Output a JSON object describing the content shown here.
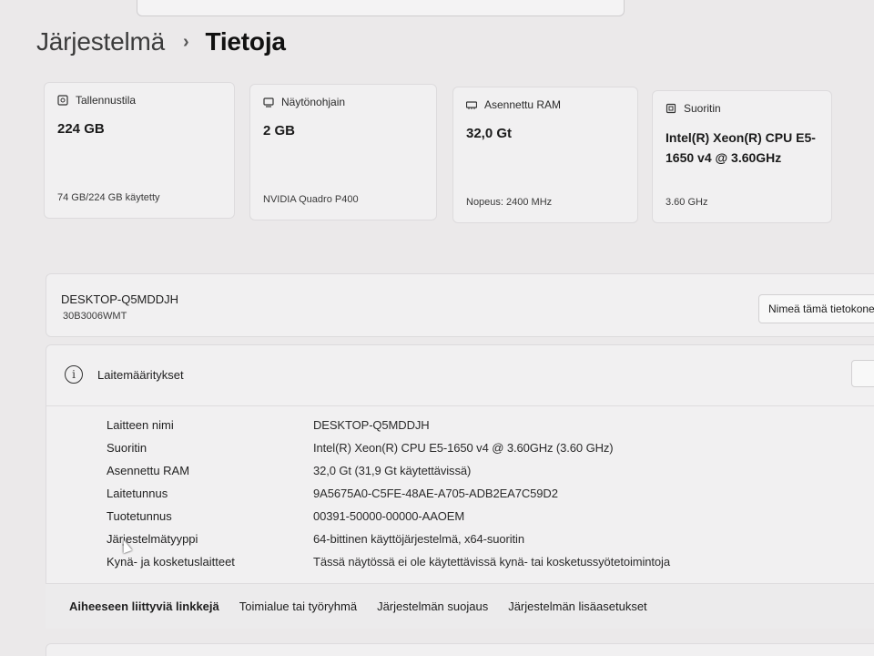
{
  "breadcrumb": {
    "parent": "Järjestelmä",
    "separator": "›",
    "current": "Tietoja"
  },
  "cards": [
    {
      "icon": "storage-icon",
      "label": "Tallennustila",
      "value": "224 GB",
      "sub": "74 GB/224 GB käytetty"
    },
    {
      "icon": "gpu-icon",
      "label": "Näytönohjain",
      "value": "2 GB",
      "sub": "NVIDIA Quadro P400"
    },
    {
      "icon": "ram-icon",
      "label": "Asennettu RAM",
      "value": "32,0 Gt",
      "sub": "Nopeus: 2400 MHz"
    },
    {
      "icon": "cpu-icon",
      "label": "Suoritin",
      "value": "Intel(R) Xeon(R) CPU E5-1650 v4 @ 3.60GHz",
      "sub": "3.60 GHz"
    }
  ],
  "device": {
    "hostname": "DESKTOP-Q5MDDJH",
    "model": "30B3006WMT",
    "rename_label": "Nimeä tämä tietokone"
  },
  "specs": {
    "title": "Laitemääritykset",
    "rows": [
      {
        "label": "Laitteen nimi",
        "value": "DESKTOP-Q5MDDJH"
      },
      {
        "label": "Suoritin",
        "value": "Intel(R) Xeon(R) CPU E5-1650 v4 @ 3.60GHz (3.60 GHz)"
      },
      {
        "label": "Asennettu RAM",
        "value": "32,0 Gt (31,9 Gt käytettävissä)"
      },
      {
        "label": "Laitetunnus",
        "value": "9A5675A0-C5FE-48AE-A705-ADB2EA7C59D2"
      },
      {
        "label": "Tuotetunnus",
        "value": "00391-50000-00000-AAOEM"
      },
      {
        "label": "Järjestelmätyyppi",
        "value": "64-bittinen käyttöjärjestelmä, x64-suoritin"
      },
      {
        "label": "Kynä- ja kosketuslaitteet",
        "value": "Tässä näytössä ei ole käytettävissä kynä- tai kosketussyötetoimintoja"
      }
    ]
  },
  "related_links": {
    "title": "Aiheeseen liittyviä linkkejä",
    "links": [
      "Toimialue tai työryhmä",
      "Järjestelmän suojaus",
      "Järjestelmän lisäasetukset"
    ]
  }
}
